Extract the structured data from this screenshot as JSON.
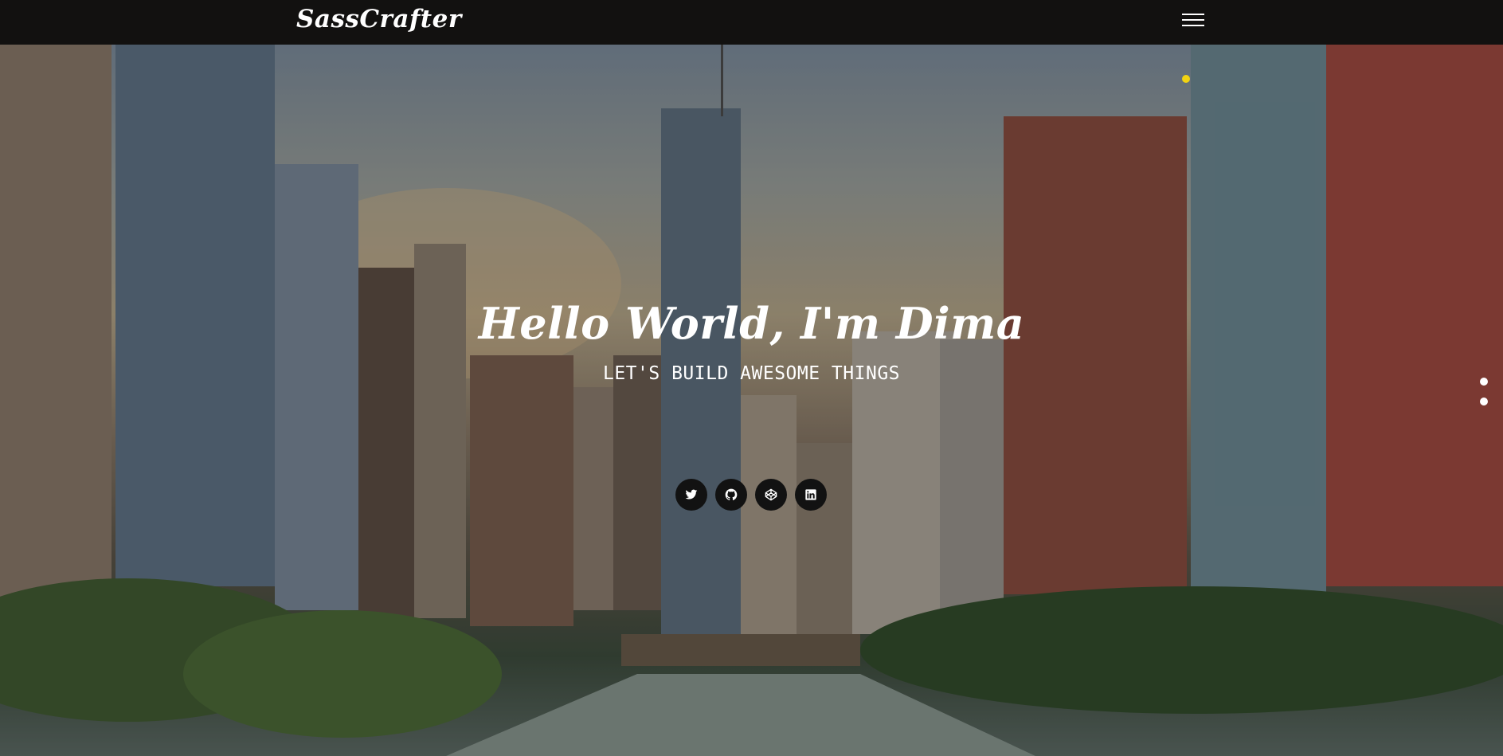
{
  "navbar": {
    "logo": "SassCrafter",
    "menu_icon": "hamburger-menu-icon"
  },
  "hero": {
    "title": "Hello World, I'm Dima",
    "subtitle": "LET'S BUILD AWESOME THINGS",
    "socials": [
      {
        "icon": "twitter-icon"
      },
      {
        "icon": "github-icon"
      },
      {
        "icon": "codepen-icon"
      },
      {
        "icon": "linkedin-icon"
      }
    ],
    "indicator_color": "#f2d312",
    "page_dots": 2
  },
  "colors": {
    "navbar_bg": "#121110",
    "button_bg": "#121212",
    "text": "#ffffff"
  }
}
